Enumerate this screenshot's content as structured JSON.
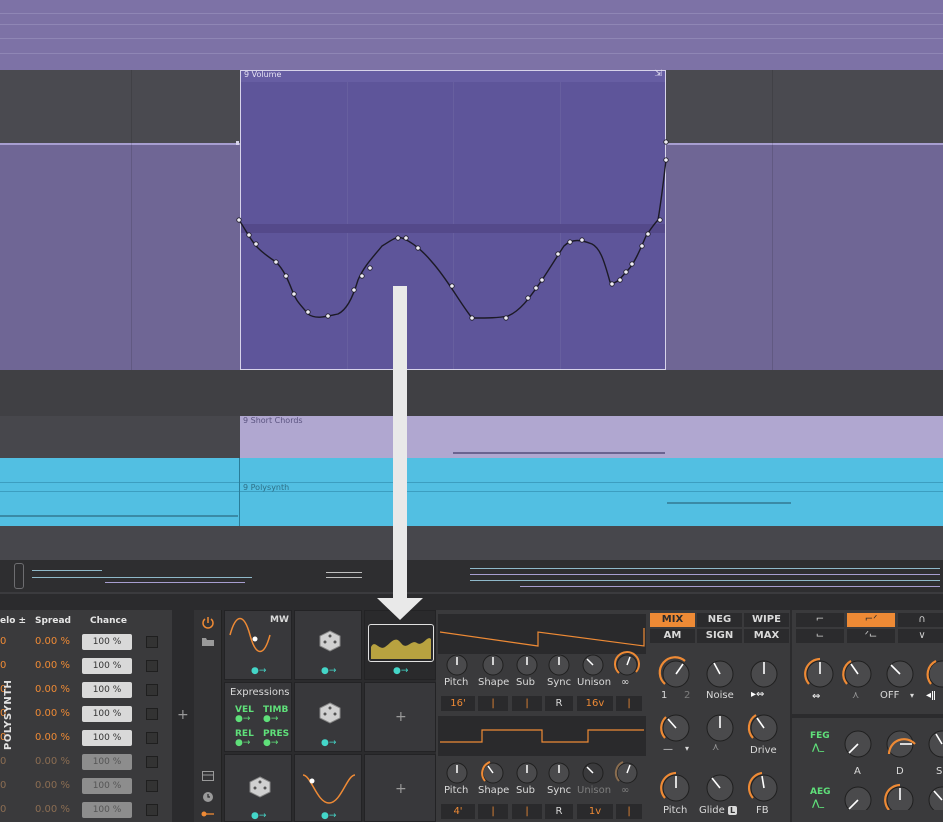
{
  "arranger": {
    "volume_clip_label": "9 Volume",
    "chords_clip_label": "9 Short Chords",
    "poly_clip_label": "9 Polysynth"
  },
  "note_table": {
    "col_velo": "elo ±",
    "col_spread": "Spread",
    "col_chance": "Chance",
    "rows": [
      {
        "velo": "0",
        "spread": "0.00 %",
        "chance": "100 %"
      },
      {
        "velo": "0",
        "spread": "0.00 %",
        "chance": "100 %"
      },
      {
        "velo": "0",
        "spread": "0.00 %",
        "chance": "100 %"
      },
      {
        "velo": "0",
        "spread": "0.00 %",
        "chance": "100 %"
      },
      {
        "velo": "0",
        "spread": "0.00 %",
        "chance": "100 %"
      },
      {
        "velo": "0",
        "spread": "0.00 %",
        "chance": "100 %"
      },
      {
        "velo": "0",
        "spread": "0.00 %",
        "chance": "100 %"
      },
      {
        "velo": "0",
        "spread": "0.00 %",
        "chance": "100 %"
      }
    ],
    "add_symbol": "+"
  },
  "device": {
    "name": "POLYSYNTH",
    "mw_label": "MW",
    "expressions_title": "Expressions",
    "expr": {
      "vel": "VEL",
      "timb": "TIMB",
      "rel": "REL",
      "pres": "PRES"
    },
    "add_symbol": "+"
  },
  "osc1": {
    "knobs": [
      "Pitch",
      "Shape",
      "Sub",
      "Sync",
      "Unison"
    ],
    "values": [
      "16'",
      "|",
      "|",
      "R",
      "16v",
      "|"
    ]
  },
  "osc2": {
    "knobs": [
      "Pitch",
      "Shape",
      "Sub",
      "Sync",
      "Unison"
    ],
    "values": [
      "4'",
      "|",
      "|",
      "R",
      "1v",
      "|"
    ]
  },
  "mixer": {
    "buttons_row1": [
      "MIX",
      "NEG",
      "WIPE"
    ],
    "buttons_row2": [
      "AM",
      "SIGN",
      "MAX"
    ],
    "osc_nums": [
      "1",
      "2"
    ],
    "noise_label": "Noise",
    "drive_label": "Drive",
    "pitch_label": "Pitch",
    "glide_label": "Glide",
    "glide_badge": "L",
    "fb_label": "FB",
    "dash_label": "—"
  },
  "filter": {
    "off_label": "OFF",
    "feg_label": "FEG",
    "aeg_label": "AEG",
    "a_label": "A",
    "d_label": "D",
    "s_label": "S"
  },
  "colors": {
    "accent": "#ee8a35",
    "clip_purple": "#5e559a",
    "track_blue": "#52bfe2",
    "mod_green": "#5fe07a",
    "arrow_teal": "#44d6c8"
  }
}
